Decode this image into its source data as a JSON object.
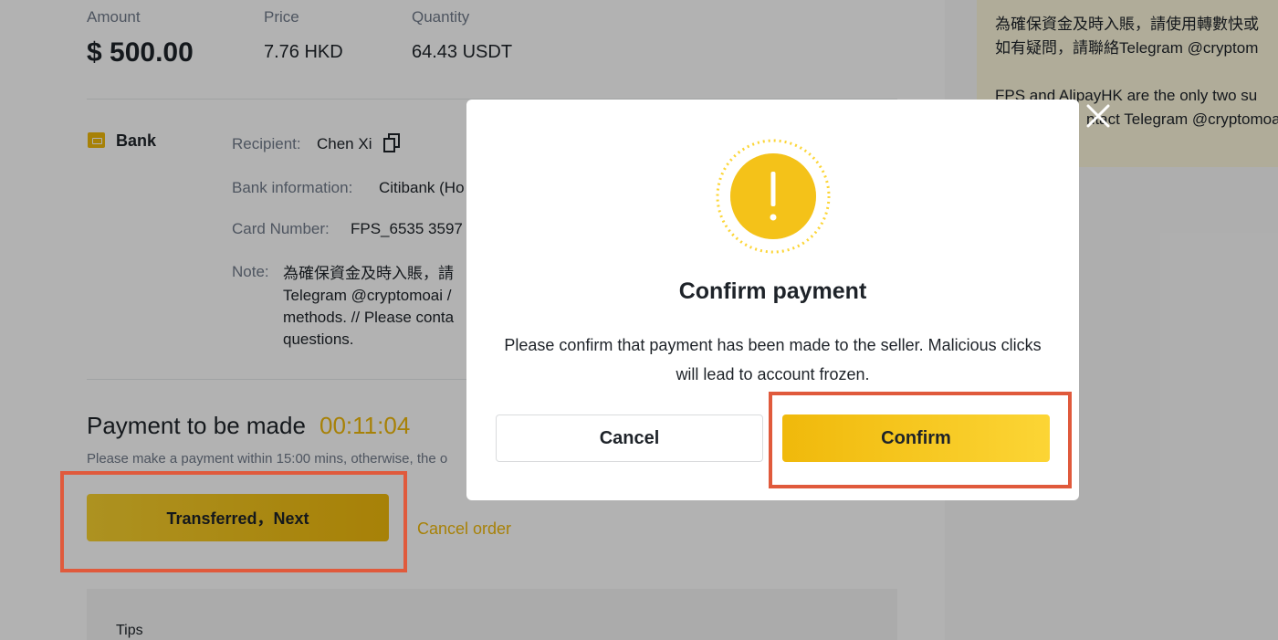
{
  "order": {
    "amount_label": "Amount",
    "amount_value": "$ 500.00",
    "price_label": "Price",
    "price_value": "7.76 HKD",
    "quantity_label": "Quantity",
    "quantity_value": "64.43 USDT"
  },
  "payment_method": {
    "name": "Bank",
    "recipient_label": "Recipient:",
    "recipient_value": "Chen Xi",
    "bank_info_label": "Bank information:",
    "bank_info_value": "Citibank (Ho",
    "card_number_label": "Card Number:",
    "card_number_value": "FPS_6535 3597",
    "note_label": "Note:",
    "note_lines": [
      "為確保資金及時入賬，請",
      "Telegram @cryptomoai /",
      "methods. // Please conta",
      "questions."
    ]
  },
  "payment_status": {
    "title": "Payment to be made",
    "timer": "00:11:04",
    "subtitle": "Please make a payment within 15:00 mins, otherwise, the o",
    "transferred_button": "Transferred，Next",
    "cancel_order": "Cancel order"
  },
  "tips": {
    "label": "Tips"
  },
  "notice_panel": {
    "lines": [
      "為確保資金及時入賬，請使用轉數快或",
      "如有疑問，請聯絡Telegram @cryptom",
      "",
      "FPS and AlipayHK are the only two su",
      "ntact Telegram @cryptomoa"
    ]
  },
  "modal": {
    "title": "Confirm payment",
    "body": "Please confirm that payment has been made to the seller. Malicious clicks will lead to account frozen.",
    "cancel_label": "Cancel",
    "confirm_label": "Confirm",
    "icon": "warning-icon"
  },
  "colors": {
    "accent": "#f0b90b",
    "highlight": "#e05a3c",
    "overlay": "rgba(0,0,0,0.30)"
  }
}
